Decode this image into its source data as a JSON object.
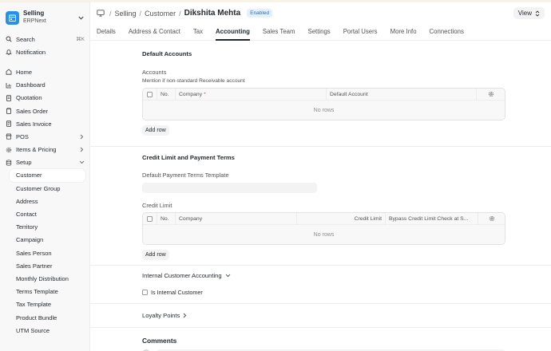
{
  "app": {
    "name": "Selling",
    "subtitle": "ERPNext"
  },
  "sidebar": {
    "search_label": "Search",
    "search_shortcut": "⌘K",
    "notification_label": "Notification",
    "items": [
      {
        "label": "Home"
      },
      {
        "label": "Dashboard"
      },
      {
        "label": "Quotation"
      },
      {
        "label": "Sales Order"
      },
      {
        "label": "Sales Invoice"
      },
      {
        "label": "POS"
      },
      {
        "label": "Items & Pricing"
      },
      {
        "label": "Setup"
      }
    ],
    "sub_items": [
      {
        "label": "Customer"
      },
      {
        "label": "Customer Group"
      },
      {
        "label": "Address"
      },
      {
        "label": "Contact"
      },
      {
        "label": "Territory"
      },
      {
        "label": "Campaign"
      },
      {
        "label": "Sales Person"
      },
      {
        "label": "Sales Partner"
      },
      {
        "label": "Monthly Distribution"
      },
      {
        "label": "Terms Template"
      },
      {
        "label": "Tax Template"
      },
      {
        "label": "Product Bundle"
      },
      {
        "label": "UTM Source"
      }
    ]
  },
  "breadcrumb": {
    "items": [
      "Selling",
      "Customer"
    ],
    "current": "Dikshita Mehta",
    "status": "Enabled"
  },
  "view_button": "View",
  "tabs": [
    {
      "label": "Details"
    },
    {
      "label": "Address & Contact"
    },
    {
      "label": "Tax"
    },
    {
      "label": "Accounting"
    },
    {
      "label": "Sales Team"
    },
    {
      "label": "Settings"
    },
    {
      "label": "Portal Users"
    },
    {
      "label": "More Info"
    },
    {
      "label": "Connections"
    }
  ],
  "default_accounts": {
    "title": "Default Accounts",
    "field_label": "Accounts",
    "field_desc": "Mention if non-standard Receivable account",
    "columns": [
      "No.",
      "Company",
      "Default Account"
    ],
    "empty_text": "No rows",
    "add_row": "Add row"
  },
  "credit_limit": {
    "title": "Credit Limit and Payment Terms",
    "payment_terms_label": "Default Payment Terms Template",
    "credit_limit_label": "Credit Limit",
    "columns": [
      "No.",
      "Company",
      "Credit Limit",
      "Bypass Credit Limit Check at S..."
    ],
    "empty_text": "No rows",
    "add_row": "Add row"
  },
  "internal_accounting": {
    "title": "Internal Customer Accounting",
    "checkbox_label": "Is Internal Customer"
  },
  "loyalty": {
    "title": "Loyalty Points"
  },
  "comments": {
    "title": "Comments"
  },
  "colors": {
    "brand": "#2490ef",
    "badge_bg": "#e4f0fd",
    "badge_text": "#2a6ebb",
    "required": "#e24c4c"
  }
}
